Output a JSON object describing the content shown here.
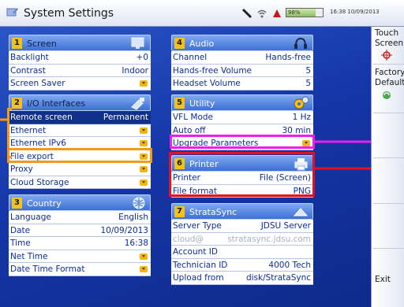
{
  "window": {
    "title": "System Settings",
    "battery": "98%",
    "datetime": "16:38 10/09/2013"
  },
  "sidebar": {
    "touch_screen": [
      "Touch",
      "Screen"
    ],
    "factory_default": [
      "Factory",
      "Default"
    ],
    "exit": "Exit"
  },
  "panels": {
    "screen": {
      "num": "1",
      "title": "Screen",
      "rows": [
        {
          "label": "Backlight",
          "value": "+0"
        },
        {
          "label": "Contrast",
          "value": "Indoor"
        },
        {
          "label": "Screen Saver",
          "value": ""
        }
      ]
    },
    "io": {
      "num": "2",
      "title": "I/O Interfaces",
      "rows": [
        {
          "label": "Remote screen",
          "value": "Permanent"
        },
        {
          "label": "Ethernet",
          "value": ""
        },
        {
          "label": "Ethernet IPv6",
          "value": ""
        },
        {
          "label": "File export",
          "value": ""
        },
        {
          "label": "Proxy",
          "value": ""
        },
        {
          "label": "Cloud Storage",
          "value": ""
        }
      ]
    },
    "country": {
      "num": "3",
      "title": "Country",
      "rows": [
        {
          "label": "Language",
          "value": "English"
        },
        {
          "label": "Date",
          "value": "10/09/2013"
        },
        {
          "label": "Time",
          "value": "16:38"
        },
        {
          "label": "Net Time",
          "value": ""
        },
        {
          "label": "Date Time Format",
          "value": ""
        }
      ]
    },
    "audio": {
      "num": "4",
      "title": "Audio",
      "rows": [
        {
          "label": "Channel",
          "value": "Hands-free"
        },
        {
          "label": "Hands-free Volume",
          "value": "5"
        },
        {
          "label": "Headset Volume",
          "value": "5"
        }
      ]
    },
    "utility": {
      "num": "5",
      "title": "Utility",
      "rows": [
        {
          "label": "VFL Mode",
          "value": "1 Hz"
        },
        {
          "label": "Auto off",
          "value": "30 min"
        },
        {
          "label": "Upgrade Parameters",
          "value": ""
        }
      ]
    },
    "printer": {
      "num": "6",
      "title": "Printer",
      "rows": [
        {
          "label": "Printer",
          "value": "File (Screen)"
        },
        {
          "label": "File format",
          "value": "PNG"
        }
      ]
    },
    "stratasync": {
      "num": "7",
      "title": "StrataSync",
      "rows": [
        {
          "label": "Server Type",
          "value": "JDSU Server"
        },
        {
          "label": "cloud@",
          "value": "stratasync.jdsu.com"
        },
        {
          "label": "Account ID",
          "value": ""
        },
        {
          "label": "Technician ID",
          "value": "4000 Tech"
        },
        {
          "label": "Upload from",
          "value": "disk/StrataSync"
        }
      ]
    }
  },
  "colors": {
    "highlight_orange": "#f29a1a",
    "highlight_magenta": "#f01cf0",
    "highlight_red": "#e8101a"
  }
}
